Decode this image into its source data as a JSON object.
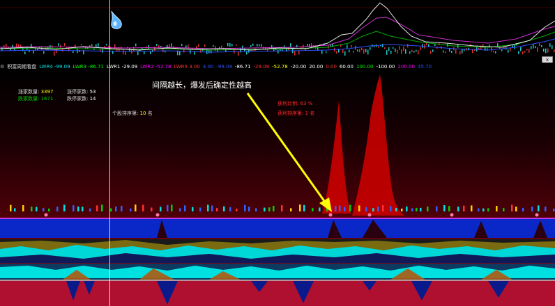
{
  "status_bar": {
    "indicator_name": "积富周期看盘",
    "items": [
      {
        "label": "LWR4",
        "value": "-99.09",
        "color": "#00e0e0"
      },
      {
        "label": "LWR3",
        "value": "-86.71",
        "color": "#00ff00"
      },
      {
        "label": "LWR1",
        "value": "-29.09",
        "color": "#ffffff"
      },
      {
        "label": "LWR2",
        "value": "-52.78",
        "color": "#ff00ff"
      },
      {
        "label": "LWR5",
        "value": "3.00",
        "color": "#ff3030"
      },
      {
        "label": "",
        "value": "3.00",
        "color": "#3050ff"
      },
      {
        "label": "",
        "value": "-99.09",
        "color": "#3050ff"
      },
      {
        "label": "",
        "value": "-86.71",
        "color": "#ffffff"
      },
      {
        "label": "",
        "value": "-29.09",
        "color": "#ff3030"
      },
      {
        "label": "",
        "value": "-52.78",
        "color": "#ffff00"
      },
      {
        "label": "",
        "value": "-20.00",
        "color": "#ffffff"
      },
      {
        "label": "",
        "value": "20.00",
        "color": "#ffffff"
      },
      {
        "label": "",
        "value": "0.00",
        "color": "#ff3030"
      },
      {
        "label": "",
        "value": "60.00",
        "color": "#ffffff"
      },
      {
        "label": "",
        "value": "100.00",
        "color": "#00ff00"
      },
      {
        "label": "",
        "value": "-100.00",
        "color": "#ffffff"
      },
      {
        "label": "",
        "value": "200.00",
        "color": "#ff00ff"
      },
      {
        "label": "",
        "value": "45.70",
        "color": "#3050ff"
      }
    ]
  },
  "stats": {
    "rise_count_label": "涨家数量:",
    "rise_count": "3397",
    "limit_up_label": "涨停家数:",
    "limit_up": "53",
    "fall_count_label": "跌家数量:",
    "fall_count": "1671",
    "limit_down_label": "跌停家数:",
    "limit_down": "14"
  },
  "rank": {
    "label": "个股排序第:",
    "value": "10",
    "unit": "名"
  },
  "annotation": {
    "text": "间隔越长，爆发后确定性越高"
  },
  "profit": {
    "ratio_label": "获利比例:",
    "ratio_value": "63 %",
    "rank_label": "获利排序第:",
    "rank_value": "1 名"
  },
  "close_badge": "✕",
  "colors": {
    "crosshair": "#ffffff",
    "arrow": "#ffff00",
    "blue_band": "#0a28c8",
    "peak": "#c40000"
  }
}
